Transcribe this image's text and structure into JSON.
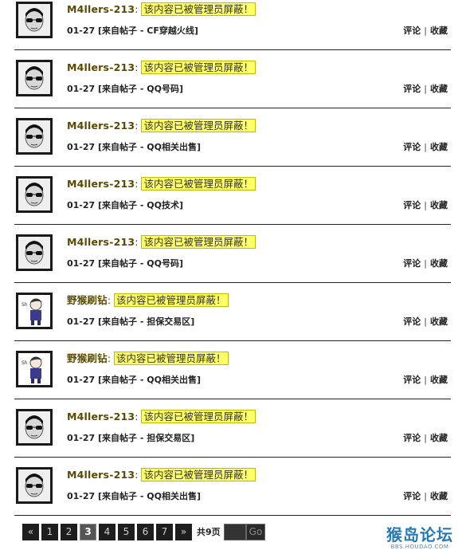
{
  "items": [
    {
      "username": "M4llers-213",
      "colon": ":",
      "content": "该内容已被管理员屏蔽！",
      "meta": "01-27 [来自帖子 - CF穿越火线]",
      "comment": "评论",
      "favorite": "收藏",
      "avatar": "avatar-glasses"
    },
    {
      "username": "M4llers-213",
      "colon": ":",
      "content": "该内容已被管理员屏蔽！",
      "meta": "01-27 [来自帖子 - QQ号码]",
      "comment": "评论",
      "favorite": "收藏",
      "avatar": "avatar-glasses"
    },
    {
      "username": "M4llers-213",
      "colon": ":",
      "content": "该内容已被管理员屏蔽！",
      "meta": "01-27 [来自帖子 - QQ相关出售]",
      "comment": "评论",
      "favorite": "收藏",
      "avatar": "avatar-glasses"
    },
    {
      "username": "M4llers-213",
      "colon": ":",
      "content": "该内容已被管理员屏蔽！",
      "meta": "01-27 [来自帖子 - QQ技术]",
      "comment": "评论",
      "favorite": "收藏",
      "avatar": "avatar-glasses"
    },
    {
      "username": "M4llers-213",
      "colon": ":",
      "content": "该内容已被管理员屏蔽！",
      "meta": "01-27 [来自帖子 - QQ号码]",
      "comment": "评论",
      "favorite": "收藏",
      "avatar": "avatar-glasses"
    },
    {
      "username": "野猴刷钻",
      "colon": ":",
      "content": "该内容已被管理员屏蔽！",
      "meta": "01-27 [来自帖子 - 担保交易区]",
      "comment": "评论",
      "favorite": "收藏",
      "avatar": "avatar-cartoon"
    },
    {
      "username": "野猴刷钻",
      "colon": ":",
      "content": "该内容已被管理员屏蔽！",
      "meta": "01-27 [来自帖子 - QQ相关出售]",
      "comment": "评论",
      "favorite": "收藏",
      "avatar": "avatar-cartoon"
    },
    {
      "username": "M4llers-213",
      "colon": ":",
      "content": "该内容已被管理员屏蔽！",
      "meta": "01-27 [来自帖子 - 担保交易区]",
      "comment": "评论",
      "favorite": "收藏",
      "avatar": "avatar-glasses"
    },
    {
      "username": "M4llers-213",
      "colon": ":",
      "content": "该内容已被管理员屏蔽！",
      "meta": "01-27 [来自帖子 - QQ相关出售]",
      "comment": "评论",
      "favorite": "收藏",
      "avatar": "avatar-glasses"
    }
  ],
  "pagination": {
    "prev": "«",
    "pages": [
      "1",
      "2",
      "3",
      "4",
      "5",
      "6",
      "7"
    ],
    "current": "3",
    "next": "»",
    "total": "共9页",
    "go_label": "Go"
  },
  "logo": {
    "text": "猴岛论坛",
    "url_text": "BBS.HOUDAO.COM"
  },
  "colors": {
    "highlight": "#ffff66",
    "username": "#5a4a00",
    "logo": "#2878b8"
  }
}
